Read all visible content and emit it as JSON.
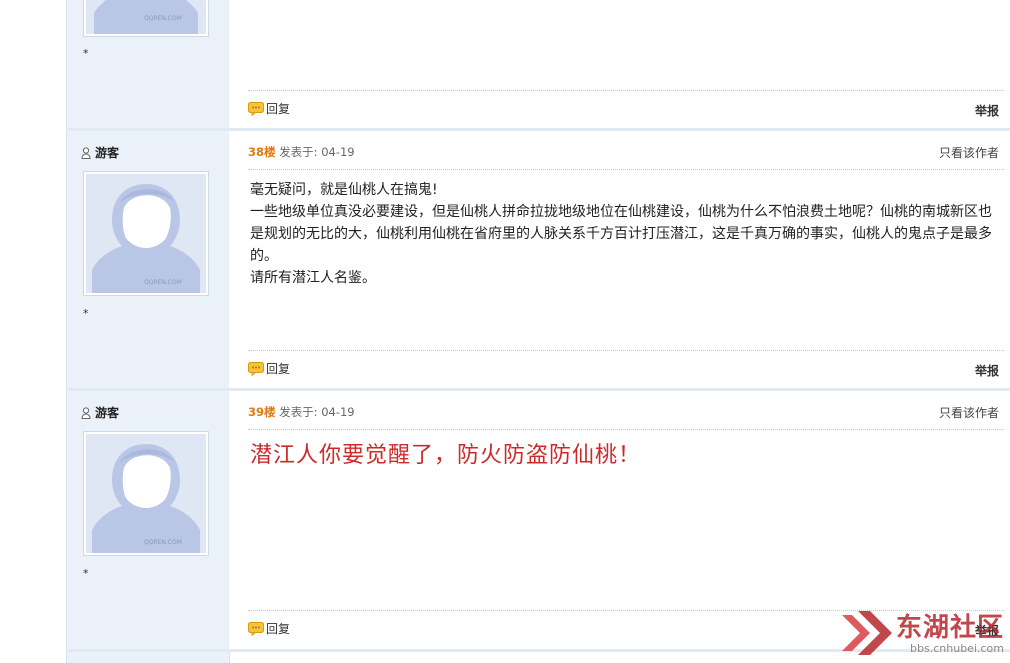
{
  "avatar_caption": "QQREN.COM",
  "star_mark": "*",
  "labels": {
    "reply": "回复",
    "report": "举报",
    "posted_at_prefix": "发表于:",
    "only_author": "只看该作者",
    "guest": "游客"
  },
  "posts": [
    {
      "floor": "38楼",
      "date": "04-19",
      "lines": [
        "毫无疑问，就是仙桃人在搞鬼!",
        "一些地级单位真没必要建设，但是仙桃人拼命拉拢地级地位在仙桃建设，仙桃为什么不怕浪费土地呢？仙桃的南城新区也是规划的无比的大，仙桃利用仙桃在省府里的人脉关系千方百计打压潜江，这是千真万确的事实，仙桃人的鬼点子是最多的。",
        "请所有潜江人名鉴。"
      ]
    },
    {
      "floor": "39楼",
      "date": "04-19",
      "lines": [
        "潜江人你要觉醒了，防火防盗防仙桃！"
      ]
    }
  ],
  "watermark": {
    "title": "东湖社区",
    "url": "bbs.cnhubei.com",
    "brand_color": "#b7272c"
  },
  "colors": {
    "floor": "#e07a12",
    "sidebar_bg": "#eaf1f8",
    "emphasis_red": "#cc2a2a"
  }
}
